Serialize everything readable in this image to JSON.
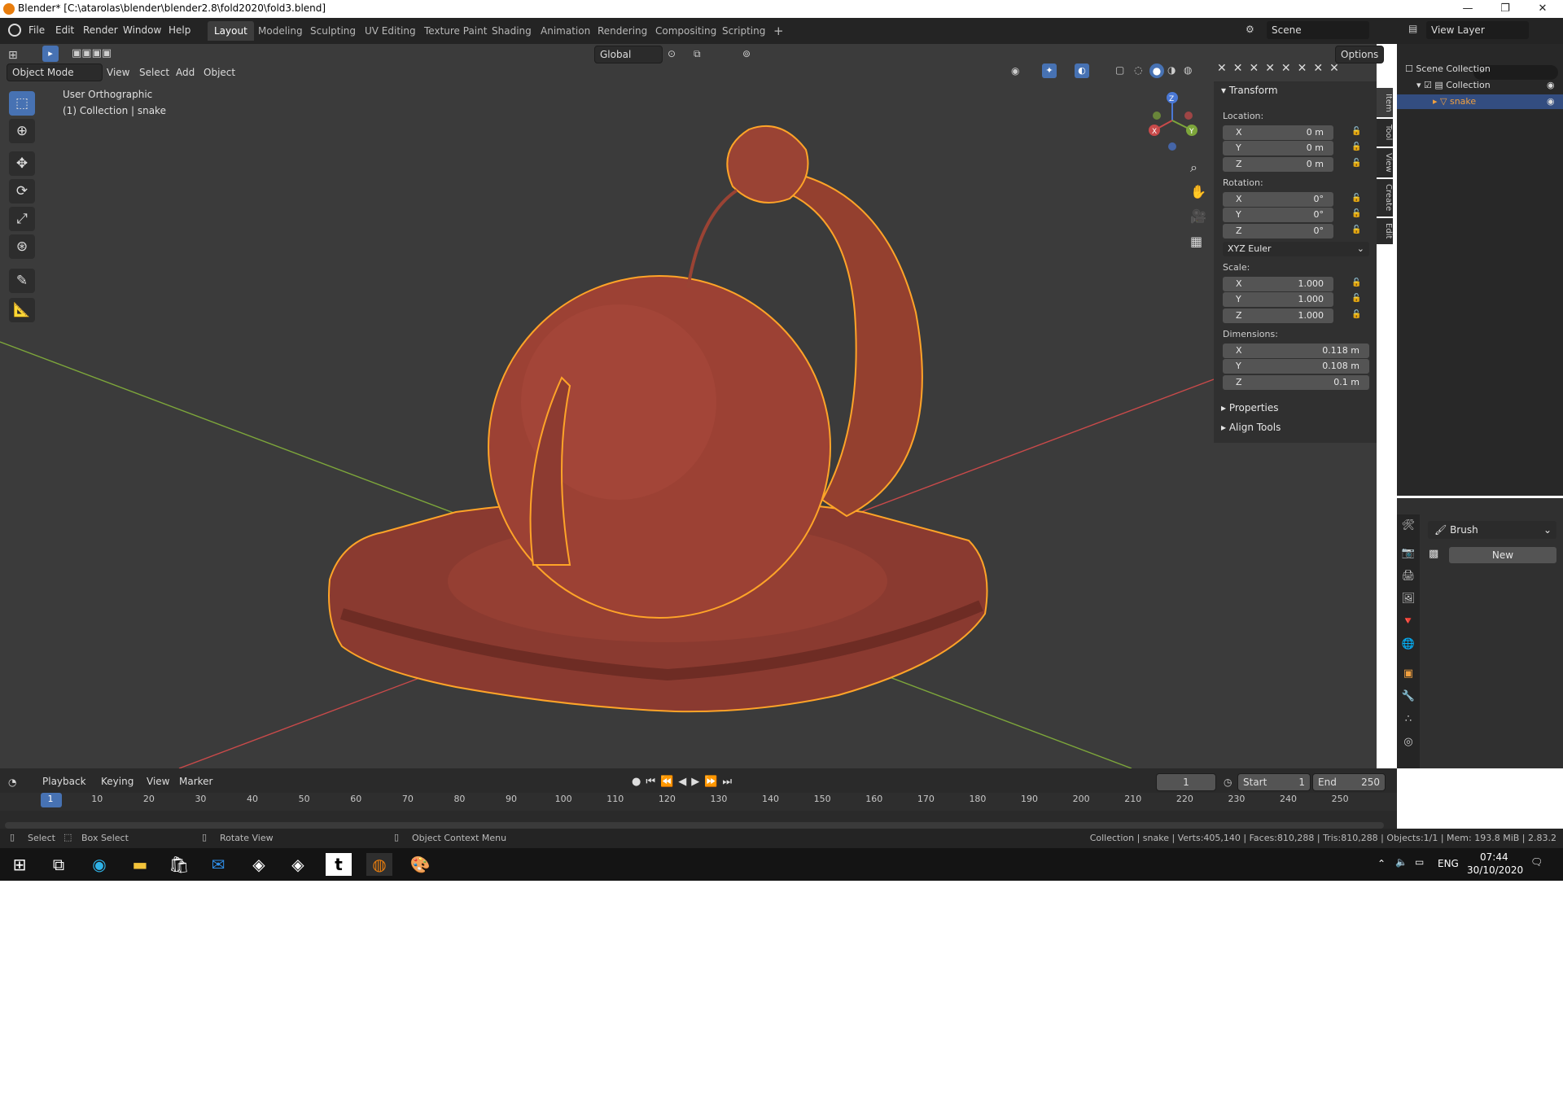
{
  "window": {
    "title": "Blender* [C:\\atarolas\\blender\\blender2.8\\fold2020\\fold3.blend]",
    "controls": [
      "—",
      "❐",
      "✕"
    ]
  },
  "menubar": {
    "items": [
      "File",
      "Edit",
      "Render",
      "Window",
      "Help"
    ]
  },
  "workspaces": {
    "tabs": [
      "Layout",
      "Modeling",
      "Sculpting",
      "UV Editing",
      "Texture Paint",
      "Shading",
      "Animation",
      "Rendering",
      "Compositing",
      "Scripting"
    ],
    "active": "Layout",
    "add": "+"
  },
  "scene": {
    "label": "Scene",
    "view_layer": "View Layer"
  },
  "viewport": {
    "mode": "Object Mode",
    "menus": [
      "View",
      "Select",
      "Add",
      "Object"
    ],
    "orientation": "Global",
    "options": "Options",
    "view_name": "User Orthographic",
    "collection_info": "(1) Collection | snake"
  },
  "transform": {
    "header": "Transform",
    "location_label": "Location:",
    "location": [
      {
        "axis": "X",
        "value": "0 m"
      },
      {
        "axis": "Y",
        "value": "0 m"
      },
      {
        "axis": "Z",
        "value": "0 m"
      }
    ],
    "rotation_label": "Rotation:",
    "rotation": [
      {
        "axis": "X",
        "value": "0°"
      },
      {
        "axis": "Y",
        "value": "0°"
      },
      {
        "axis": "Z",
        "value": "0°"
      }
    ],
    "rotation_mode": "XYZ Euler",
    "scale_label": "Scale:",
    "scale": [
      {
        "axis": "X",
        "value": "1.000"
      },
      {
        "axis": "Y",
        "value": "1.000"
      },
      {
        "axis": "Z",
        "value": "1.000"
      }
    ],
    "dimensions_label": "Dimensions:",
    "dimensions": [
      {
        "axis": "X",
        "value": "0.118 m"
      },
      {
        "axis": "Y",
        "value": "0.108 m"
      },
      {
        "axis": "Z",
        "value": "0.1 m"
      }
    ],
    "properties": "Properties",
    "align_tools": "Align Tools"
  },
  "sidebar_tabs": [
    "Item",
    "Tool",
    "View",
    "Create",
    "Edit"
  ],
  "outliner": {
    "root": "Scene Collection",
    "collection": "Collection",
    "object": "snake"
  },
  "properties_panel": {
    "brush_label": "Brush",
    "new_label": "New"
  },
  "timeline": {
    "menus": [
      "Playback",
      "Keying",
      "View",
      "Marker"
    ],
    "current_frame": "1",
    "start_label": "Start",
    "start": "1",
    "end_label": "End",
    "end": "250",
    "ruler": [
      "1",
      "10",
      "20",
      "30",
      "40",
      "50",
      "60",
      "70",
      "80",
      "90",
      "100",
      "110",
      "120",
      "130",
      "140",
      "150",
      "160",
      "170",
      "180",
      "190",
      "200",
      "210",
      "220",
      "230",
      "240",
      "250"
    ]
  },
  "statusbar": {
    "select": "Select",
    "box_select": "Box Select",
    "rotate_view": "Rotate View",
    "context_menu": "Object Context Menu",
    "stats": "Collection | snake | Verts:405,140 | Faces:810,288 | Tris:810,288 | Objects:1/1 | Mem: 193.8 MiB | 2.83.2"
  },
  "taskbar": {
    "language": "ENG",
    "time": "07:44",
    "date": "30/10/2020"
  },
  "colors": {
    "accent": "#4772b3",
    "model": "#9a3f33",
    "outline": "#ffa428",
    "x_axis": "#c94a4a",
    "y_axis": "#7da63b"
  }
}
